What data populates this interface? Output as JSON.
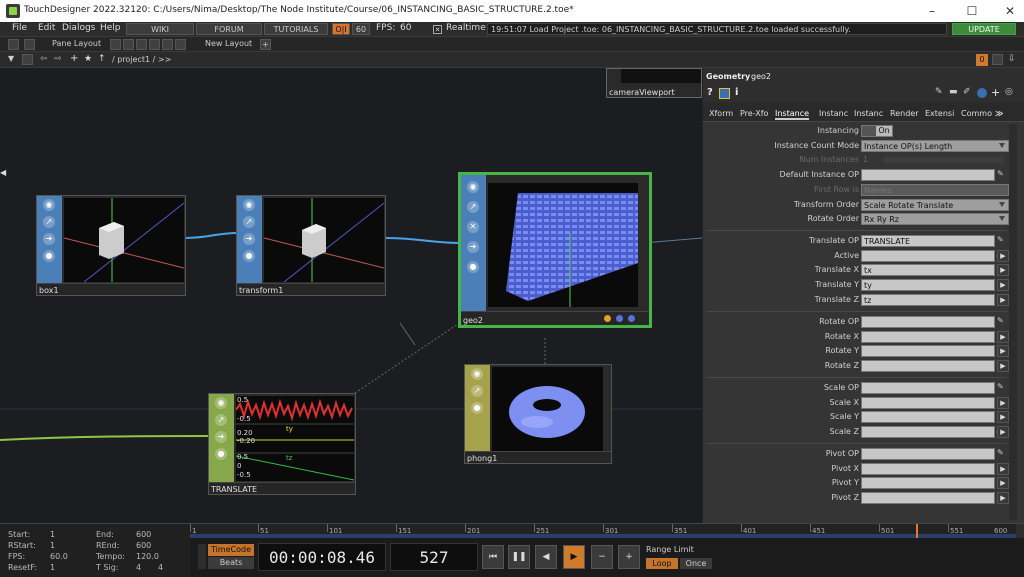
{
  "window": {
    "title": "TouchDesigner 2022.32120: C:/Users/Nima/Desktop/The Node Institute/Course/06_INSTANCING_BASIC_STRUCTURE.2.toe*"
  },
  "menu": {
    "items": [
      "File",
      "Edit",
      "Dialogs",
      "Help"
    ],
    "wiki": "WIKI",
    "forum": "FORUM",
    "tutorials": "TUTORIALS",
    "oi": "O|I",
    "fps_target": "60",
    "fps_label": "FPS:",
    "fps_value": "60",
    "realtime": "Realtime",
    "status": "19:51:07 Load Project .toe: 06_INSTANCING_BASIC_STRUCTURE.2.toe loaded successfully.",
    "update": "UPDATE"
  },
  "toolbar": {
    "pane_layout": "Pane Layout",
    "new_layout": "New Layout",
    "path": "/ project1 / >>",
    "pane_number": "0"
  },
  "nodes": {
    "box1": "box1",
    "transform1": "transform1",
    "geo2": "geo2",
    "phong1": "phong1",
    "translate": "TRANSLATE",
    "camera": "cameraViewport",
    "translate_chop": {
      "v1": "0.5",
      "v2": "-0.5",
      "v3": "0.20",
      "v4": "-0.20",
      "v5": "0.5",
      "v6": "0",
      "v7": "-0.5",
      "ch_ty": "ty",
      "ch_tz": "tz"
    }
  },
  "params": {
    "op_type": "Geometry",
    "op_name": "geo2",
    "tabs": [
      "Xform",
      "Pre-Xfo",
      "Instance",
      "Instanc",
      "Instanc",
      "Render",
      "Extensi",
      "Commo"
    ],
    "active_tab": "Instance",
    "instancing_label": "Instancing",
    "instancing_value": "On",
    "instance_count_mode_label": "Instance Count Mode",
    "instance_count_mode_value": "Instance OP(s) Length",
    "num_instances_label": "Num Instances",
    "num_instances_value": "1",
    "default_instance_op_label": "Default Instance OP",
    "first_row_label": "First Row is",
    "first_row_value": "Names",
    "transform_order_label": "Transform Order",
    "transform_order_value": "Scale Rotate Translate",
    "rotate_order_label": "Rotate Order",
    "rotate_order_value": "Rx Ry Rz",
    "translate_op_label": "Translate OP",
    "translate_op_value": "TRANSLATE",
    "active_label": "Active",
    "translate_x_label": "Translate X",
    "translate_x_value": "tx",
    "translate_y_label": "Translate Y",
    "translate_y_value": "ty",
    "translate_z_label": "Translate Z",
    "translate_z_value": "tz",
    "rotate_op_label": "Rotate OP",
    "rotate_x_label": "Rotate X",
    "rotate_y_label": "Rotate Y",
    "rotate_z_label": "Rotate Z",
    "scale_op_label": "Scale OP",
    "scale_x_label": "Scale X",
    "scale_y_label": "Scale Y",
    "scale_z_label": "Scale Z",
    "pivot_op_label": "Pivot OP",
    "pivot_x_label": "Pivot X",
    "pivot_y_label": "Pivot Y",
    "pivot_z_label": "Pivot Z"
  },
  "timeline": {
    "ticks": [
      "1",
      "51",
      "101",
      "151",
      "201",
      "251",
      "301",
      "351",
      "401",
      "451",
      "501",
      "551",
      "600"
    ],
    "start_label": "Start:",
    "start_value": "1",
    "rstart_label": "RStart:",
    "rstart_value": "1",
    "fps_label": "FPS:",
    "fps_value": "60.0",
    "resetf_label": "ResetF:",
    "resetf_value": "1",
    "end_label": "End:",
    "end_value": "600",
    "rend_label": "REnd:",
    "rend_value": "600",
    "tempo_label": "Tempo:",
    "tempo_value": "120.0",
    "tsig_label": "T Sig:",
    "tsig_value1": "4",
    "tsig_value2": "4",
    "timecode_label": "TimeCode",
    "beats_label": "Beats",
    "timecode": "00:00:08.46",
    "frame": "527",
    "range_limit": "Range Limit",
    "loop": "Loop",
    "once": "Once"
  }
}
